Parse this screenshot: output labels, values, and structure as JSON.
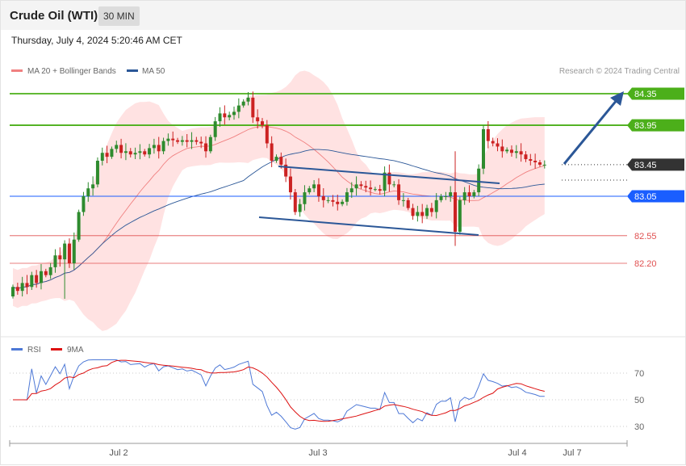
{
  "header": {
    "title": "Crude Oil (WTI)",
    "timeframe": "30 MIN",
    "datetime": "Thursday, July 4, 2024 5:20:46 AM CET"
  },
  "legend": {
    "ma20_label": "MA 20 + Bollinger Bands",
    "ma50_label": "MA 50",
    "copyright": "Research © 2024 Trading Central",
    "rsi_label": "RSI",
    "rsi_ma_label": "9MA"
  },
  "colors": {
    "resistance": "#4caf1a",
    "support_blue": "#1a5eff",
    "support_red": "#e05050",
    "price_tag": "#333333",
    "ma50": "#2b5797",
    "band_fill": "#ffd6d6",
    "bull": "#2e8b2e",
    "bear": "#cc2222",
    "rsi": "#4d78d6",
    "rsi_ma": "#dd1111"
  },
  "chart_data": [
    {
      "type": "candlestick",
      "title": "Crude Oil (WTI)",
      "timeframe": "30 MIN",
      "x_labels": [
        "Jul 2",
        "Jul 3",
        "Jul 4",
        "Jul 7"
      ],
      "levels": [
        {
          "value": 84.35,
          "label": "84.35",
          "role": "resistance",
          "color": "#4caf1a"
        },
        {
          "value": 83.95,
          "label": "83.95",
          "role": "resistance",
          "color": "#4caf1a"
        },
        {
          "value": 83.45,
          "label": "83.45",
          "role": "last price",
          "color": "#333333"
        },
        {
          "value": 83.05,
          "label": "83.05",
          "role": "support",
          "color": "#1a5eff"
        },
        {
          "value": 82.55,
          "label": "82.55",
          "role": "support",
          "color": "#e05050"
        },
        {
          "value": 82.2,
          "label": "82.20",
          "role": "support",
          "color": "#e05050"
        }
      ],
      "approx_close": [
        81.9,
        81.85,
        81.95,
        81.9,
        82.05,
        81.95,
        82.1,
        82.05,
        82.15,
        82.3,
        82.25,
        82.45,
        82.2,
        82.5,
        82.85,
        83.05,
        83.15,
        83.2,
        83.5,
        83.6,
        83.55,
        83.65,
        83.7,
        83.6,
        83.62,
        83.58,
        83.6,
        83.62,
        83.58,
        83.66,
        83.7,
        83.62,
        83.75,
        83.78,
        83.76,
        83.74,
        83.76,
        83.74,
        83.76,
        83.74,
        83.72,
        83.62,
        83.8,
        84.0,
        84.1,
        84.05,
        84.08,
        84.12,
        84.2,
        84.25,
        84.3,
        84.05,
        84.0,
        83.95,
        83.72,
        83.5,
        83.55,
        83.45,
        83.3,
        83.1,
        82.85,
        82.95,
        83.1,
        83.15,
        83.2,
        83.05,
        83.0,
        83.0,
        82.98,
        82.95,
        82.98,
        83.1,
        83.15,
        83.2,
        83.18,
        83.16,
        83.14,
        83.14,
        83.12,
        83.35,
        83.2,
        83.2,
        83.0,
        83.0,
        82.9,
        82.8,
        82.85,
        82.8,
        82.9,
        82.85,
        83.0,
        83.05,
        83.05,
        83.1,
        82.6,
        83.0,
        83.1,
        83.05,
        83.1,
        83.4,
        83.9,
        83.75,
        83.72,
        83.68,
        83.62,
        83.64,
        83.6,
        83.62,
        83.58,
        83.52,
        83.5,
        83.48,
        83.45,
        83.45
      ],
      "rsi": {
        "series": [
          {
            "name": "RSI"
          },
          {
            "name": "9MA"
          }
        ],
        "levels": [
          70,
          50,
          30
        ],
        "approx_rsi_range": [
          32,
          78
        ]
      }
    }
  ]
}
